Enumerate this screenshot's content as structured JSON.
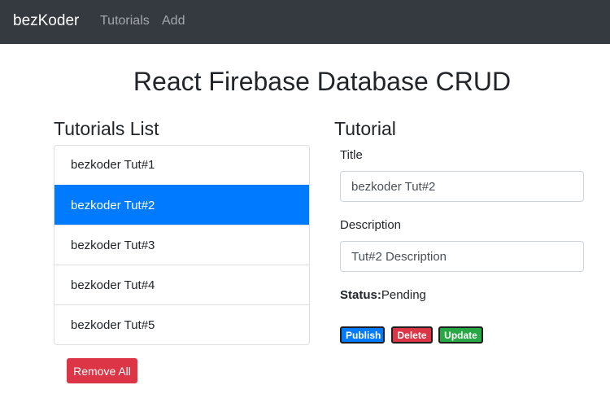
{
  "nav": {
    "brand": "bezKoder",
    "links": [
      "Tutorials",
      "Add"
    ]
  },
  "page": {
    "title": "React Firebase Database CRUD"
  },
  "list": {
    "heading": "Tutorials List",
    "items": [
      "bezkoder Tut#1",
      "bezkoder Tut#2",
      "bezkoder Tut#3",
      "bezkoder Tut#4",
      "bezkoder Tut#5"
    ],
    "selected_index": 1,
    "remove_all_label": "Remove All"
  },
  "detail": {
    "heading": "Tutorial",
    "title_label": "Title",
    "title_value": "bezkoder Tut#2",
    "description_label": "Description",
    "description_value": "Tut#2 Description",
    "status_label": "Status:",
    "status_value": "Pending",
    "buttons": {
      "publish": "Publish",
      "delete": "Delete",
      "update": "Update"
    }
  },
  "colors": {
    "navbar": "#343a40",
    "primary": "#007bff",
    "danger": "#dc3545",
    "success": "#28a745"
  }
}
